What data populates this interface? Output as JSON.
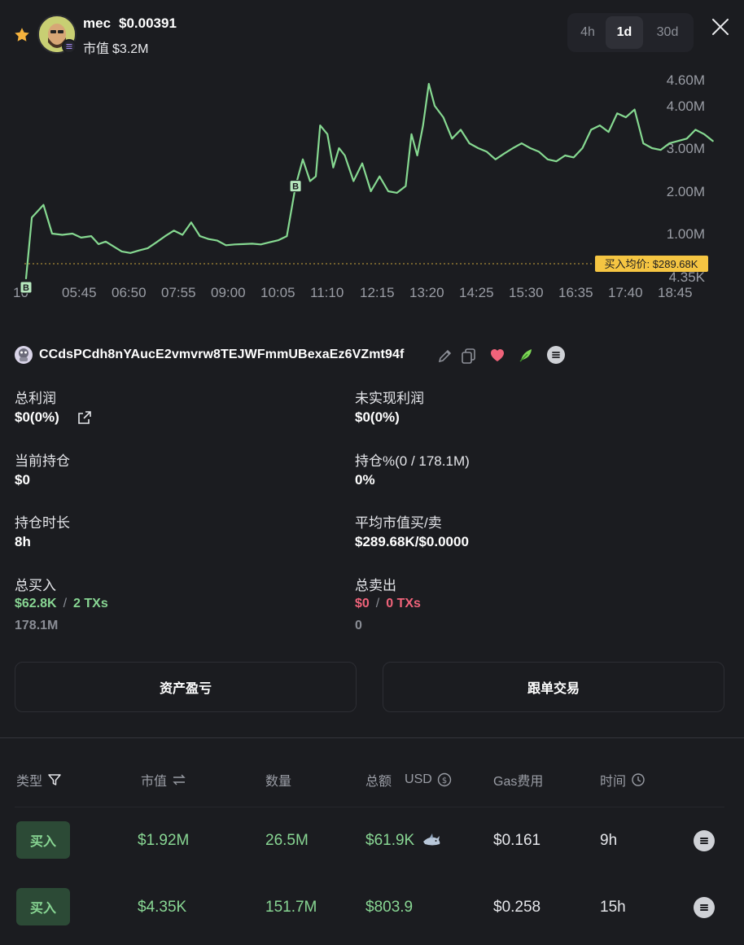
{
  "header": {
    "token_name": "mec",
    "token_price": "$0.00391",
    "mcap_label": "市值",
    "mcap_value": "$3.2M",
    "timeframes": [
      "4h",
      "1d",
      "30d"
    ],
    "active_timeframe": "1d"
  },
  "chart_data": {
    "type": "line",
    "x_ticks": [
      "10",
      "05:45",
      "06:50",
      "07:55",
      "09:00",
      "10:05",
      "11:10",
      "12:15",
      "13:20",
      "14:25",
      "15:30",
      "16:35",
      "17:40",
      "18:45"
    ],
    "y_ticks": [
      "4.60M",
      "4.00M",
      "3.00M",
      "2.00M",
      "1.00M",
      "4.35K"
    ],
    "y_scale": "log",
    "avg_buy_label": "买入均价: $289.68K",
    "avg_buy_value": 289680,
    "buy_markers": [
      "B",
      "B"
    ],
    "series_color": "#86d991",
    "points": [
      [
        0,
        4350
      ],
      [
        0.4,
        1300000
      ],
      [
        1.2,
        1600000
      ],
      [
        1.8,
        1000000
      ],
      [
        2.5,
        950000
      ],
      [
        3.2,
        1000000
      ],
      [
        3.8,
        850000
      ],
      [
        4.5,
        900000
      ],
      [
        5.0,
        650000
      ],
      [
        5.5,
        720000
      ],
      [
        6.0,
        600000
      ],
      [
        6.6,
        480000
      ],
      [
        7.2,
        450000
      ],
      [
        7.8,
        500000
      ],
      [
        8.4,
        550000
      ],
      [
        9.0,
        700000
      ],
      [
        9.6,
        900000
      ],
      [
        10.2,
        1050000
      ],
      [
        10.8,
        950000
      ],
      [
        11.4,
        1200000
      ],
      [
        12.0,
        900000
      ],
      [
        12.6,
        800000
      ],
      [
        13.2,
        750000
      ],
      [
        13.8,
        620000
      ],
      [
        14.4,
        640000
      ],
      [
        15.0,
        650000
      ],
      [
        15.6,
        660000
      ],
      [
        16.2,
        640000
      ],
      [
        16.8,
        700000
      ],
      [
        17.4,
        760000
      ],
      [
        18.0,
        900000
      ],
      [
        18.6,
        2100000
      ],
      [
        19.1,
        2700000
      ],
      [
        19.6,
        2200000
      ],
      [
        20.0,
        2300000
      ],
      [
        20.3,
        3500000
      ],
      [
        20.8,
        3300000
      ],
      [
        21.2,
        2500000
      ],
      [
        21.6,
        3000000
      ],
      [
        22.0,
        2800000
      ],
      [
        22.6,
        2200000
      ],
      [
        23.2,
        2600000
      ],
      [
        23.8,
        2000000
      ],
      [
        24.4,
        2300000
      ],
      [
        25.0,
        2000000
      ],
      [
        25.6,
        1950000
      ],
      [
        26.2,
        2100000
      ],
      [
        26.6,
        3300000
      ],
      [
        27.0,
        2800000
      ],
      [
        27.4,
        3500000
      ],
      [
        27.8,
        4500000
      ],
      [
        28.2,
        4000000
      ],
      [
        28.8,
        3700000
      ],
      [
        29.4,
        3200000
      ],
      [
        30.0,
        3400000
      ],
      [
        30.6,
        3100000
      ],
      [
        31.2,
        3000000
      ],
      [
        31.8,
        2900000
      ],
      [
        32.4,
        2700000
      ],
      [
        33.0,
        2850000
      ],
      [
        33.6,
        3000000
      ],
      [
        34.2,
        3100000
      ],
      [
        34.8,
        3000000
      ],
      [
        35.4,
        2900000
      ],
      [
        36.0,
        2700000
      ],
      [
        36.6,
        2650000
      ],
      [
        37.2,
        2800000
      ],
      [
        37.8,
        2750000
      ],
      [
        38.4,
        3000000
      ],
      [
        39.0,
        3400000
      ],
      [
        39.6,
        3500000
      ],
      [
        40.2,
        3350000
      ],
      [
        40.8,
        3800000
      ],
      [
        41.4,
        3700000
      ],
      [
        42.0,
        3900000
      ],
      [
        42.6,
        3100000
      ],
      [
        43.2,
        3000000
      ],
      [
        43.8,
        2950000
      ],
      [
        44.4,
        3100000
      ],
      [
        45.0,
        3150000
      ],
      [
        45.6,
        3200000
      ],
      [
        46.2,
        3400000
      ],
      [
        46.8,
        3300000
      ],
      [
        47.4,
        3150000
      ]
    ]
  },
  "wallet": {
    "address": "CCdsPCdh8nYAucE2vmvrw8TEJWFmmUBexaEz6VZmt94f"
  },
  "stats": {
    "total_profit_label": "总利润",
    "total_profit_value": "$0(0%)",
    "unrealized_label": "未实现利润",
    "unrealized_value": "$0(0%)",
    "holding_label": "当前持仓",
    "holding_value": "$0",
    "holding_pct_label": "持仓%(0 / 178.1M)",
    "holding_pct_value": "0%",
    "duration_label": "持仓时长",
    "duration_value": "8h",
    "avg_mcap_label": "平均市值买/卖",
    "avg_mcap_value": "$289.68K/$0.0000",
    "total_buy_label": "总买入",
    "total_buy_amount": "$62.8K",
    "total_buy_sep": "/",
    "total_buy_txs": "2 TXs",
    "total_buy_qty": "178.1M",
    "total_sell_label": "总卖出",
    "total_sell_amount": "$0",
    "total_sell_sep": "/",
    "total_sell_txs": "0 TXs",
    "total_sell_qty": "0"
  },
  "actions": {
    "pnl_label": "资产盈亏",
    "copy_trade_label": "跟单交易"
  },
  "table": {
    "headers": {
      "type": "类型",
      "mcap": "市值",
      "qty": "数量",
      "total": "总额",
      "currency": "USD",
      "gas": "Gas费用",
      "time": "时间"
    },
    "rows": [
      {
        "type": "买入",
        "mcap": "$1.92M",
        "qty": "26.5M",
        "total": "$61.9K",
        "gas": "$0.161",
        "time": "9h"
      },
      {
        "type": "买入",
        "mcap": "$4.35K",
        "qty": "151.7M",
        "total": "$803.9",
        "gas": "$0.258",
        "time": "15h"
      }
    ]
  },
  "colors": {
    "green": "#88d693",
    "red": "#f0637a",
    "avg_line": "#f5c542"
  }
}
